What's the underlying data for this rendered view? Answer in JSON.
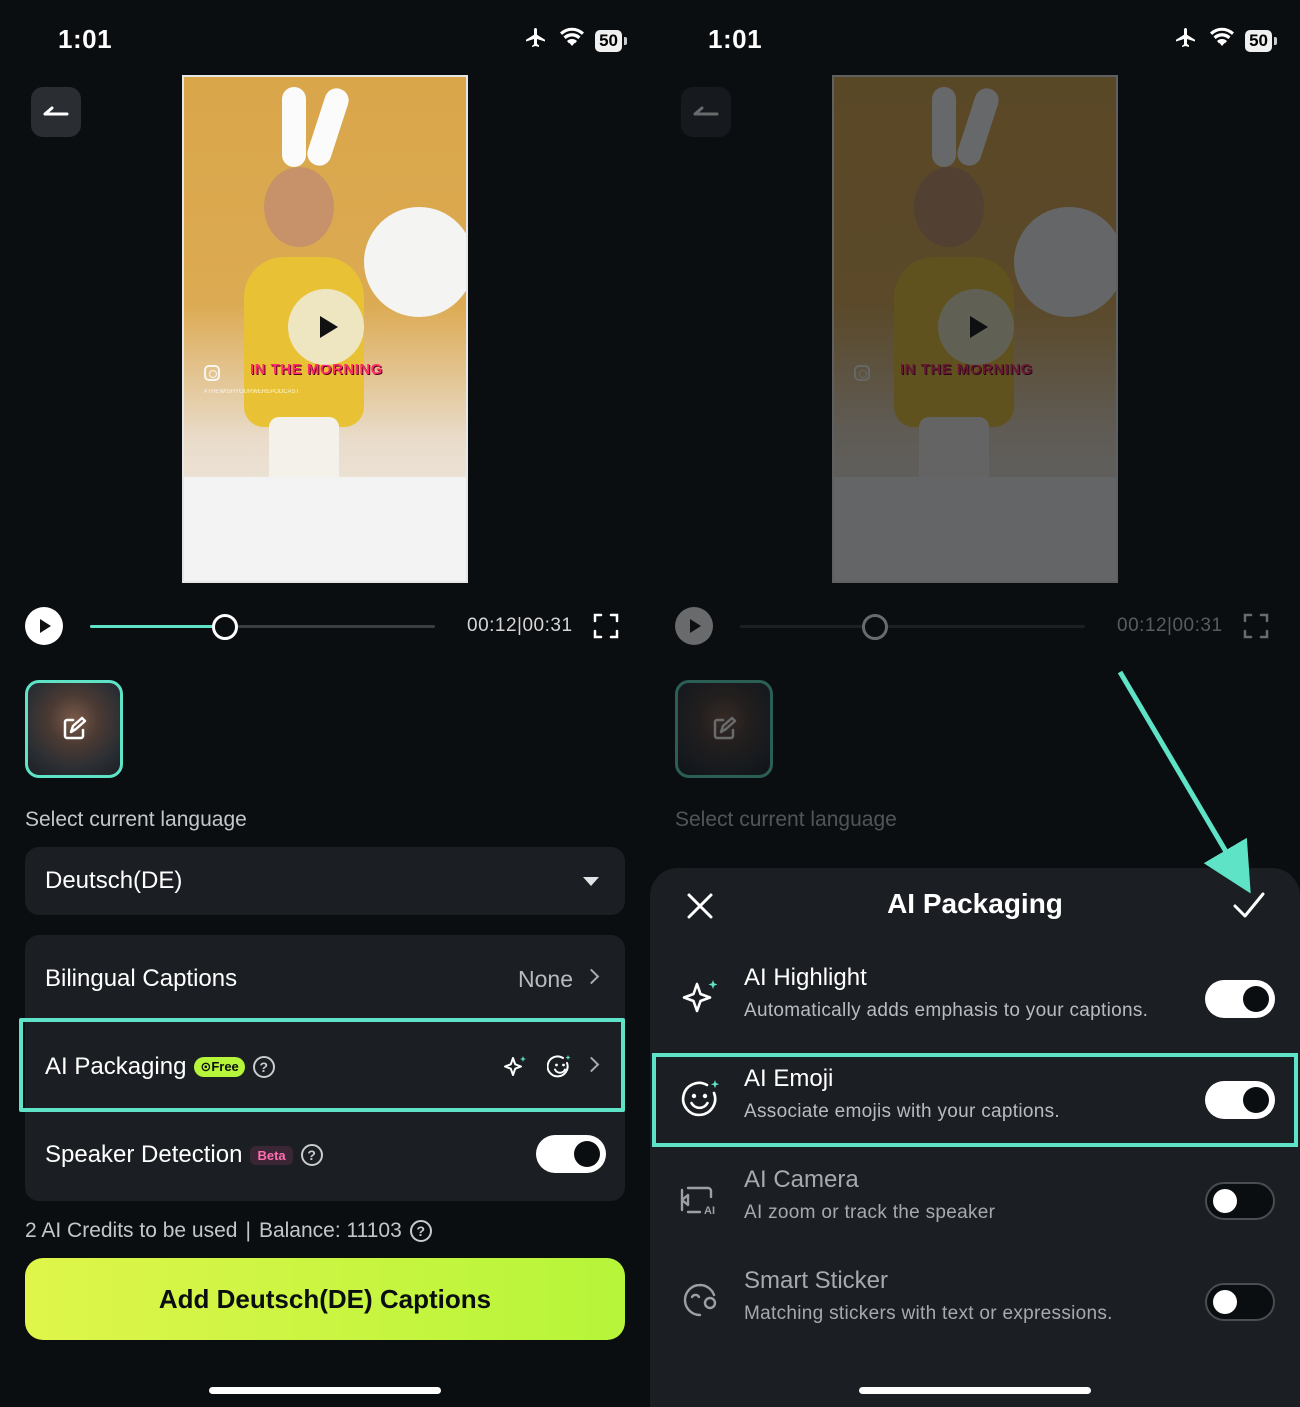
{
  "colors": {
    "accent_teal": "#5fe3c6",
    "cta_green": "#c6f53e",
    "background": "#0b0e11",
    "card": "#1b1f23",
    "beta_pink": "#ff6fb0"
  },
  "left": {
    "status": {
      "time": "1:01",
      "battery": "50"
    },
    "video": {
      "caption": "IN THE MORNING",
      "handle": "#THEWISHYOURWEREPODCAST"
    },
    "player": {
      "time": "00:12|00:31",
      "progress_fraction": 0.39
    },
    "language_label": "Select current language",
    "language_value": "Deutsch(DE)",
    "settings": {
      "bilingual": {
        "label": "Bilingual Captions",
        "value": "None"
      },
      "packaging": {
        "label": "AI Packaging",
        "badge": "Free"
      },
      "speaker": {
        "label": "Speaker Detection",
        "badge": "Beta",
        "enabled": true
      }
    },
    "credits": "2 AI Credits to be used",
    "separator": "|",
    "balance": "Balance: 11103",
    "cta": "Add Deutsch(DE) Captions"
  },
  "right": {
    "status": {
      "time": "1:01",
      "battery": "50"
    },
    "video": {
      "caption": "IN THE MORNING"
    },
    "player": {
      "time": "00:12|00:31",
      "progress_fraction": 0.39
    },
    "language_label": "Select current language",
    "sheet": {
      "title": "AI Packaging",
      "items": [
        {
          "name": "AI Highlight",
          "desc": "Automatically adds emphasis to your captions.",
          "enabled": true,
          "icon": "sparkle-icon"
        },
        {
          "name": "AI Emoji",
          "desc": "Associate emojis with your captions.",
          "enabled": true,
          "icon": "emoji-icon"
        },
        {
          "name": "AI Camera",
          "desc": "AI zoom or track the speaker",
          "enabled": false,
          "icon": "camera-ai-icon"
        },
        {
          "name": "Smart Sticker",
          "desc": "Matching stickers with text or expressions.",
          "enabled": false,
          "icon": "sticker-icon"
        }
      ]
    }
  }
}
